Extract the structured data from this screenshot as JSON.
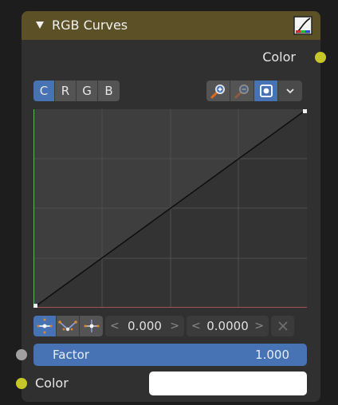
{
  "node": {
    "title": "RGB Curves",
    "output_label": "Color",
    "channels": [
      "C",
      "R",
      "G",
      "B"
    ],
    "active_channel": "C",
    "tools": [
      "zoom-in-icon",
      "zoom-out-icon",
      "clip-icon",
      "chevron-down-icon"
    ],
    "handle_x": "0.000",
    "handle_y": "0.0000",
    "factor_label": "Factor",
    "factor_value": "1.000",
    "color_input_label": "Color",
    "color_input_value": "#ffffff"
  },
  "colors": {
    "header": "#5b5026",
    "accent": "#4772b3",
    "socket_color": "#c7c729",
    "socket_float": "#a1a1a1"
  }
}
